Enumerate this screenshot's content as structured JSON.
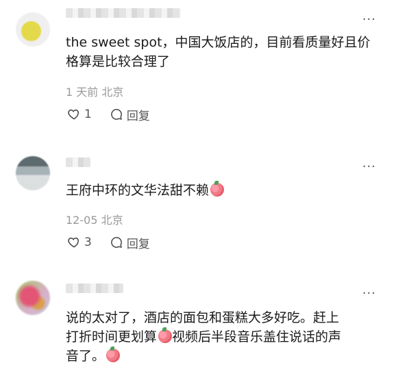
{
  "comments": [
    {
      "text": "the sweet spot，中国大饭店的，目前看质量好且价格算是比较合理了",
      "meta": "1 天前 北京",
      "likes": "1",
      "reply_label": "回复",
      "more_label": "···"
    },
    {
      "text": "王府中环的文华法甜不赖",
      "meta": "12-05 北京",
      "likes": "3",
      "reply_label": "回复",
      "more_label": "···"
    },
    {
      "text_line1": "说的太对了，酒店的面包和蛋糕大多好吃。赶上",
      "text_line2a": "打折时间更划算",
      "text_line2b": "视频后半段音乐盖住说话的声",
      "text_line3": "音了。",
      "more_label": "···"
    }
  ],
  "icons": {
    "like": "heart-icon",
    "reply": "comment-bubble-icon",
    "emoji": "peach-emoji-icon",
    "more": "ellipsis-icon"
  }
}
